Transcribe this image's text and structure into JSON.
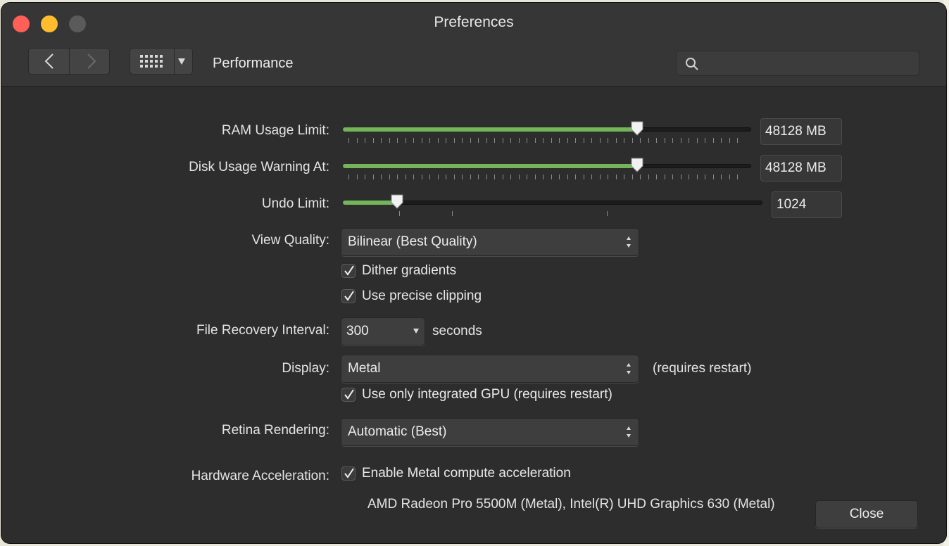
{
  "window": {
    "title": "Preferences"
  },
  "toolbar": {
    "section": "Performance",
    "search_placeholder": ""
  },
  "ram": {
    "label": "RAM Usage Limit:",
    "value": "48128 MB",
    "level": 0.72
  },
  "disk": {
    "label": "Disk Usage Warning At:",
    "value": "48128 MB",
    "level": 0.72
  },
  "undo": {
    "label": "Undo Limit:",
    "value": "1024",
    "level": 0.13
  },
  "view_quality": {
    "label": "View Quality:",
    "selected": "Bilinear (Best Quality)",
    "checkboxes": [
      {
        "label": "Dither gradients",
        "checked": true
      },
      {
        "label": "Use precise clipping",
        "checked": true
      }
    ]
  },
  "file_recovery": {
    "label": "File Recovery Interval:",
    "value": "300",
    "unit": "seconds"
  },
  "display": {
    "label": "Display:",
    "selected": "Metal",
    "note": "(requires restart)",
    "checkbox": {
      "label": "Use only integrated GPU (requires restart)",
      "checked": true
    }
  },
  "retina": {
    "label": "Retina Rendering:",
    "selected": "Automatic (Best)"
  },
  "hardware": {
    "label": "Hardware Acceleration:",
    "checkbox": {
      "label": "Enable Metal compute acceleration",
      "checked": true
    },
    "info": "AMD Radeon Pro 5500M (Metal), Intel(R) UHD Graphics 630 (Metal)"
  },
  "buttons": {
    "close": "Close"
  },
  "colors": {
    "accent": "#74b55a",
    "window_bg": "#2d2d2d",
    "red": "#fe5f57",
    "yellow": "#febc2e"
  },
  "icons": [
    "back-icon",
    "forward-icon",
    "grid-icon",
    "search-icon",
    "checkmark-icon",
    "updown-arrows-icon"
  ]
}
